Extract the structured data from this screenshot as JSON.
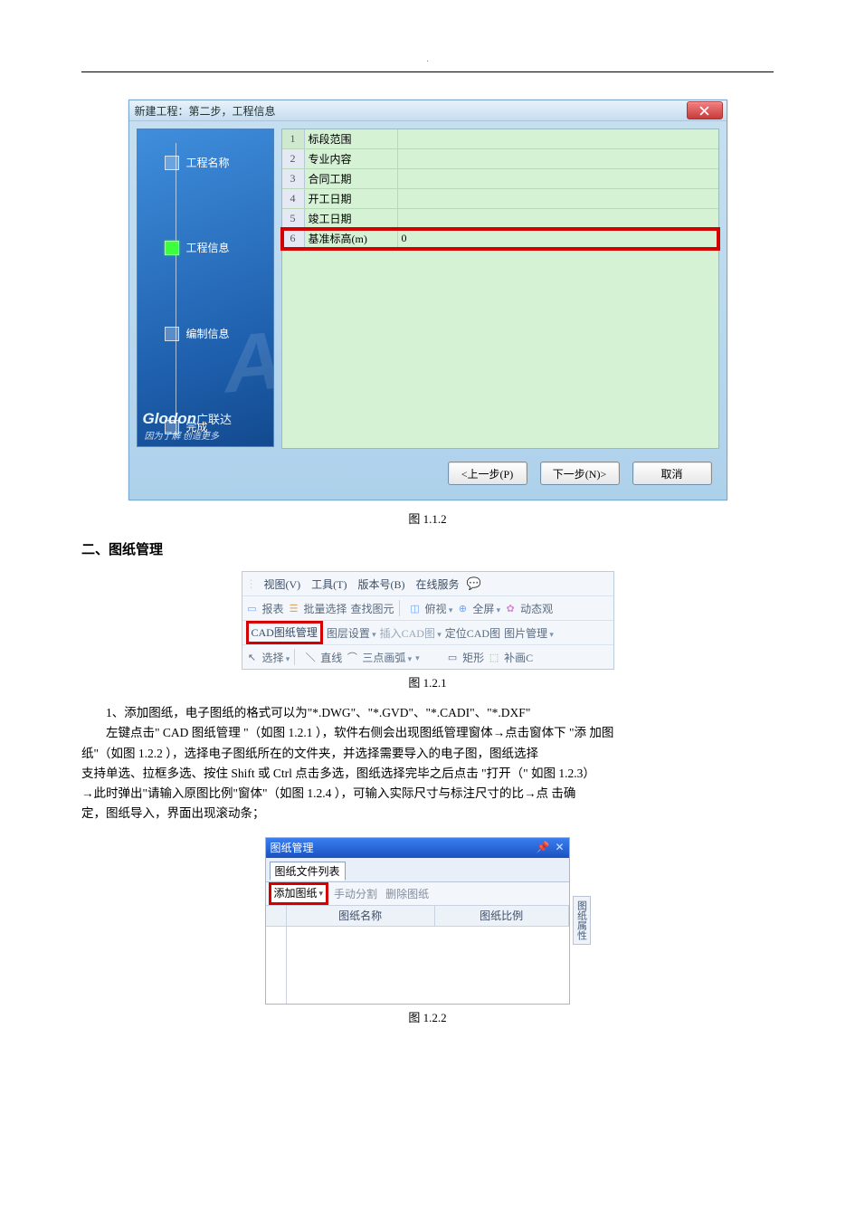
{
  "dialog1": {
    "title": "新建工程：第二步，工程信息",
    "steps": {
      "s1": "工程名称",
      "s2": "工程信息",
      "s3": "编制信息",
      "s4": "完成"
    },
    "logo": "Glodon",
    "logo_cn": "广联达",
    "slogan": "因为了解 创造更多",
    "rows": [
      {
        "idx": "1",
        "label": "标段范围",
        "value": ""
      },
      {
        "idx": "2",
        "label": "专业内容",
        "value": ""
      },
      {
        "idx": "3",
        "label": "合同工期",
        "value": ""
      },
      {
        "idx": "4",
        "label": "开工日期",
        "value": ""
      },
      {
        "idx": "5",
        "label": "竣工日期",
        "value": ""
      },
      {
        "idx": "6",
        "label": "基准标高(m)",
        "value": "0"
      }
    ],
    "buttons": {
      "prev": "<上一步(P)",
      "next": "下一步(N)>",
      "cancel": "取消"
    }
  },
  "caption1": "图 1.1.2",
  "section2": "二、图纸管理",
  "toolbar": {
    "menu": {
      "view": "视图(V)",
      "tool": "工具(T)",
      "ver": "版本号(B)",
      "online": "在线服务"
    },
    "row2": {
      "report": "报表",
      "batch": "批量选择",
      "find": "查找图元",
      "top": "俯视",
      "full": "全屏",
      "dyn": "动态观"
    },
    "row3": {
      "cadmgr": "CAD图纸管理",
      "layer": "图层设置",
      "insert": "插入CAD图",
      "locate": "定位CAD图",
      "pic": "图片管理"
    },
    "row4": {
      "select": "选择",
      "line": "直线",
      "arc": "三点画弧",
      "rect": "矩形",
      "fill": "补画C"
    }
  },
  "caption2": "图 1.2.1",
  "text": {
    "p1": "1、添加图纸，电子图纸的格式可以为\"*.DWG\"、\"*.GVD\"、\"*.CADI\"、\"*.DXF\"",
    "p2a": "左键点击\" CAD 图纸管理 \"（如图 1.2.1 ），软件右侧会出现图纸管理窗体→点击窗体下  \"添 加图",
    "p2b": "纸\"（如图  1.2.2 ），选择电子图纸所在的文件夹，并选择需要导入的电子图，图纸选择",
    "p3": "支持单选、拉框多选、按住   Shift 或 Ctrl 点击多选，图纸选择完毕之后点击  \"打开（\" 如图 1.2.3）",
    "p4": "→此时弹出\"请输入原图比例\"窗体\"（如图  1.2.4 ），可输入实际尺寸与标注尺寸的比→点  击确",
    "p5": "定，图纸导入，界面出现滚动条；"
  },
  "panel": {
    "title": "图纸管理",
    "tab": "图纸文件列表",
    "add": "添加图纸",
    "manual": "手动分割",
    "del": "删除图纸",
    "col_name": "图纸名称",
    "col_ratio": "图纸比例",
    "dock": "图纸属性"
  },
  "caption3": "图 1.2.2"
}
